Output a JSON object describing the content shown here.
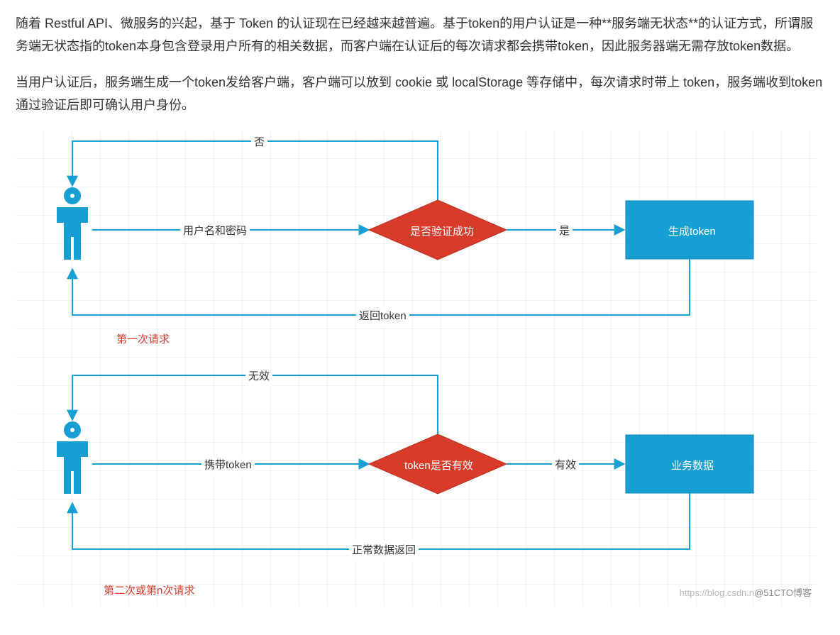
{
  "paragraphs": {
    "p1": "随着 Restful API、微服务的兴起，基于 Token 的认证现在已经越来越普遍。基于token的用户认证是一种**服务端无状态**的认证方式，所谓服务端无状态指的token本身包含登录用户所有的相关数据，而客户端在认证后的每次请求都会携带token，因此服务器端无需存放token数据。",
    "p2": " 当用户认证后，服务端生成一个token发给客户端，客户端可以放到 cookie 或 localStorage 等存储中，每次请求时带上 token，服务端收到token通过验证后即可确认用户身份。"
  },
  "diagram1": {
    "caption": "第一次请求",
    "edge_to_decision": "用户名和密码",
    "decision": "是否验证成功",
    "edge_no": "否",
    "edge_yes": "是",
    "box": "生成token",
    "edge_return": "返回token"
  },
  "diagram2": {
    "caption": "第二次或第n次请求",
    "edge_to_decision": "携带token",
    "decision": "token是否有效",
    "edge_no": "无效",
    "edge_yes": "有效",
    "box": "业务数据",
    "edge_return": "正常数据返回"
  },
  "watermark": {
    "faint": "https://blog.csdn.n",
    "dark": "@51CTO博客"
  }
}
